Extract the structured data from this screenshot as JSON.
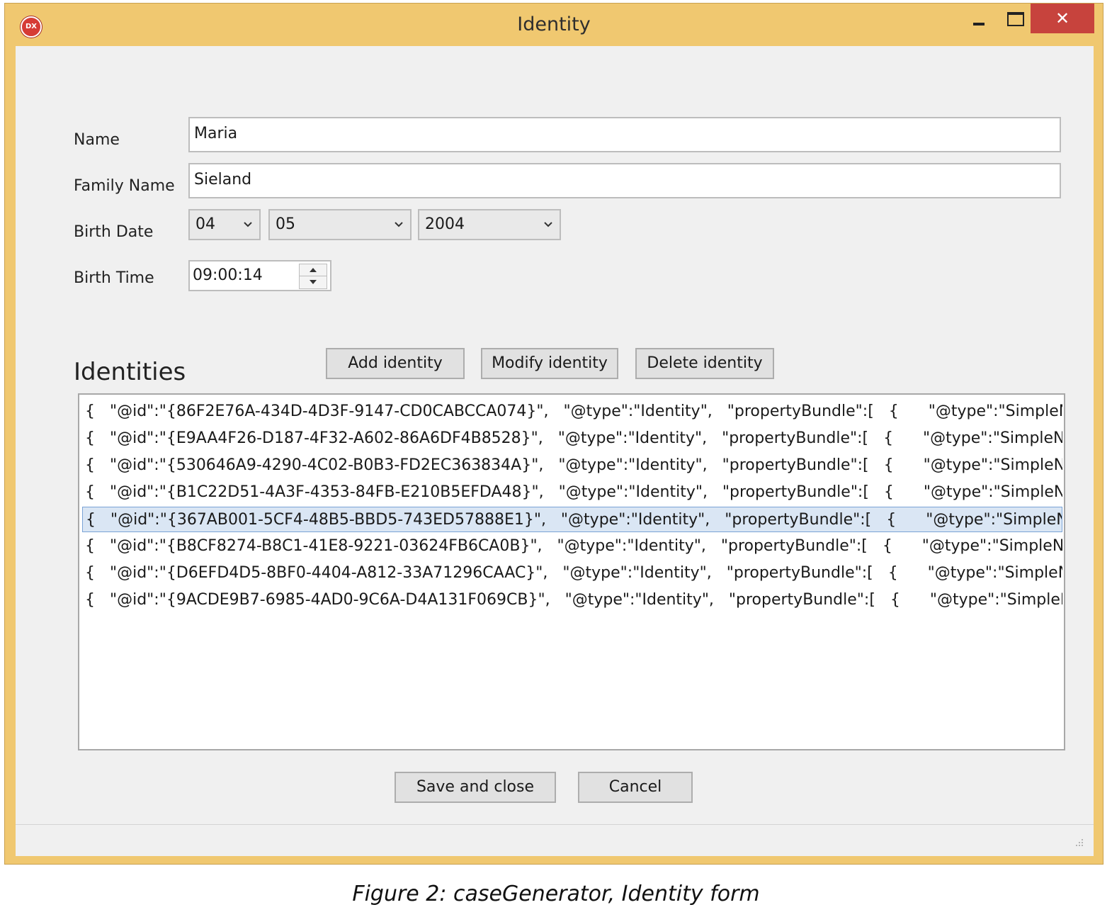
{
  "window": {
    "title": "Identity",
    "icon_text": "DX",
    "controls": {
      "close_glyph": "✕"
    }
  },
  "form": {
    "name_label": "Name",
    "name_value": "Maria",
    "family_label": "Family Name",
    "family_value": "Sieland",
    "birth_date_label": "Birth Date",
    "day_value": "04",
    "month_value": "05",
    "year_value": "2004",
    "birth_time_label": "Birth Time",
    "time_value": "09:00:14"
  },
  "identities": {
    "heading": "Identities",
    "add_label": "Add identity",
    "modify_label": "Modify identity",
    "delete_label": "Delete identity",
    "selected_index": 4,
    "rows": [
      "{   \"@id\":\"{86F2E76A-434D-4D3F-9147-CD0CABCCA074}\",   \"@type\":\"Identity\",   \"propertyBundle\":[   {      \"@type\":\"SimpleName\",",
      "{   \"@id\":\"{E9AA4F26-D187-4F32-A602-86A6DF4B8528}\",   \"@type\":\"Identity\",   \"propertyBundle\":[   {      \"@type\":\"SimpleName\",",
      "{   \"@id\":\"{530646A9-4290-4C02-B0B3-FD2EC363834A}\",   \"@type\":\"Identity\",   \"propertyBundle\":[   {      \"@type\":\"SimpleName\",",
      "{   \"@id\":\"{B1C22D51-4A3F-4353-84FB-E210B5EFDA48}\",   \"@type\":\"Identity\",   \"propertyBundle\":[   {      \"@type\":\"SimpleName\",",
      "{   \"@id\":\"{367AB001-5CF4-48B5-BBD5-743ED57888E1}\",   \"@type\":\"Identity\",   \"propertyBundle\":[   {      \"@type\":\"SimpleName\",",
      "{   \"@id\":\"{B8CF8274-B8C1-41E8-9221-03624FB6CA0B}\",   \"@type\":\"Identity\",   \"propertyBundle\":[   {      \"@type\":\"SimpleName\",",
      "{   \"@id\":\"{D6EFD4D5-8BF0-4404-A812-33A71296CAAC}\",   \"@type\":\"Identity\",   \"propertyBundle\":[   {      \"@type\":\"SimpleName\",",
      "{   \"@id\":\"{9ACDE9B7-6985-4AD0-9C6A-D4A131F069CB}\",   \"@type\":\"Identity\",   \"propertyBundle\":[   {      \"@type\":\"SimpleName\""
    ]
  },
  "footer": {
    "save_label": "Save and close",
    "cancel_label": "Cancel"
  },
  "caption": "Figure 2: caseGenerator, Identity form",
  "colors": {
    "title_bar": "#f0c870",
    "close_button": "#c7433d",
    "selection": "#dae6f4"
  }
}
